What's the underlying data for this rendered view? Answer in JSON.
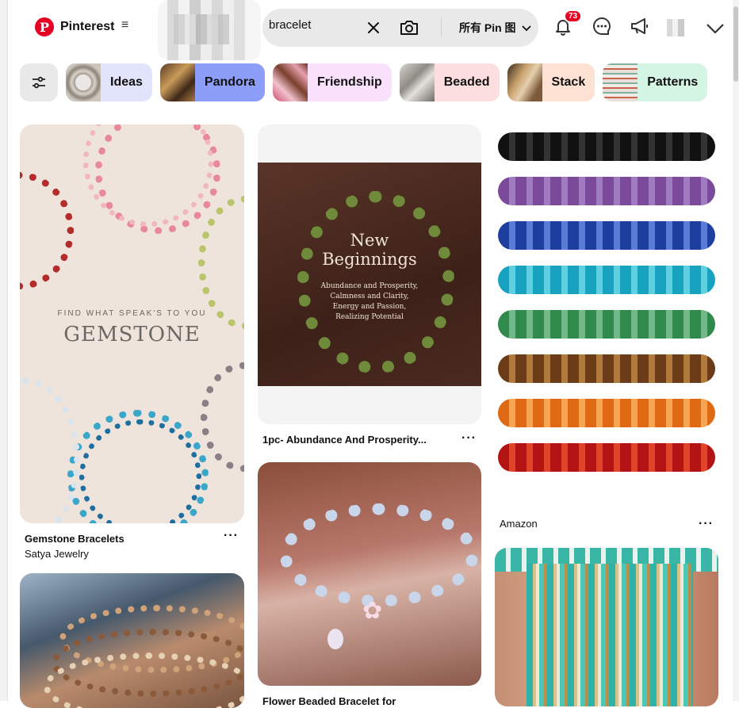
{
  "header": {
    "logo_text": "Pinterest",
    "menu_icon": "≡",
    "search": {
      "value": "bracelet",
      "scope_label": "所有 Pin 图"
    },
    "notifications_count": "73"
  },
  "chips": [
    {
      "label": "Ideas",
      "color": "#e1e4fa"
    },
    {
      "label": "Pandora",
      "color": "#8c9ef7"
    },
    {
      "label": "Friendship",
      "color": "#f9e1fb"
    },
    {
      "label": "Beaded",
      "color": "#fddede"
    },
    {
      "label": "Stack",
      "color": "#fde1d2"
    },
    {
      "label": "Patterns",
      "color": "#d4f5e3"
    }
  ],
  "pins": [
    {
      "title": "Gemstone Bracelets",
      "subtitle": "Satya Jewelry",
      "overlay_top": "FIND WHAT SPEAK'S TO YOU",
      "overlay_main": "GEMSTONE"
    },
    {
      "title": "1pc- Abundance And Prosperity...",
      "overlay_heading": "New Beginnings",
      "overlay_body": "Abundance and Prosperity, Calmness and Clarity, Energy and Passion, Realizing Potential"
    },
    {
      "title": "Amazon"
    },
    {
      "title": "Flower Beaded Bracelet for"
    }
  ],
  "more_label": "···"
}
